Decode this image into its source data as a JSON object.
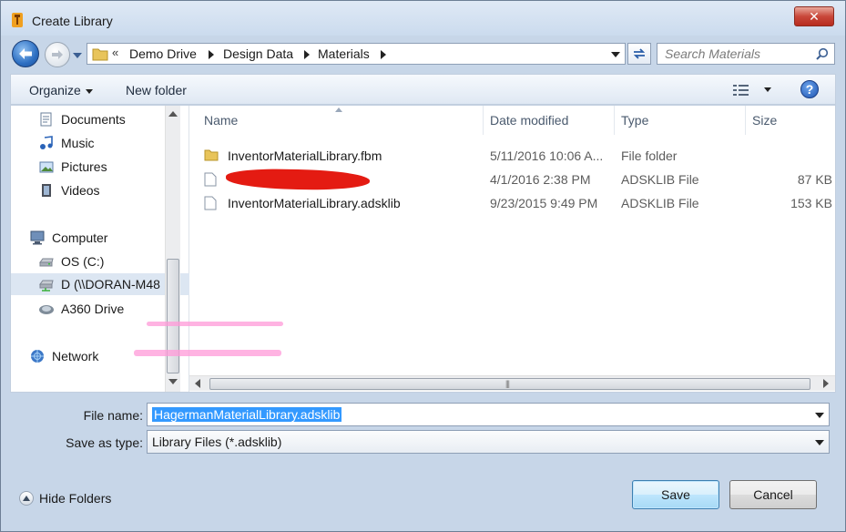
{
  "window": {
    "title": "Create Library",
    "close_label": "✕"
  },
  "address": {
    "overflow": "«",
    "crumbs": [
      "Demo Drive",
      "Design Data",
      "Materials"
    ]
  },
  "search": {
    "placeholder": "Search Materials"
  },
  "toolbar": {
    "organize": "Organize",
    "new_folder": "New folder",
    "help": "?"
  },
  "nav": {
    "items": [
      {
        "label": "Documents",
        "icon": "documents-icon"
      },
      {
        "label": "Music",
        "icon": "music-icon"
      },
      {
        "label": "Pictures",
        "icon": "pictures-icon"
      },
      {
        "label": "Videos",
        "icon": "videos-icon"
      },
      {
        "label": "Computer",
        "icon": "computer-icon"
      },
      {
        "label": "OS (C:)",
        "icon": "drive-icon"
      },
      {
        "label": "D (\\\\DORAN-M48",
        "icon": "network-drive-icon",
        "selected": true
      },
      {
        "label": "A360 Drive",
        "icon": "cloud-drive-icon"
      },
      {
        "label": "Network",
        "icon": "network-icon"
      }
    ]
  },
  "list": {
    "columns": {
      "name": "Name",
      "date": "Date modified",
      "type": "Type",
      "size": "Size"
    },
    "rows": [
      {
        "name": "InventorMaterialLibrary.fbm",
        "date": "5/11/2016 10:06 A...",
        "type": "File folder",
        "size": "",
        "icon": "folder-icon",
        "redacted": false
      },
      {
        "name": "",
        "date": "4/1/2016 2:38 PM",
        "type": "ADSKLIB File",
        "size": "87 KB",
        "icon": "file-icon",
        "redacted": true
      },
      {
        "name": "InventorMaterialLibrary.adsklib",
        "date": "9/23/2015 9:49 PM",
        "type": "ADSKLIB File",
        "size": "153 KB",
        "icon": "file-icon",
        "redacted": false
      }
    ]
  },
  "form": {
    "file_name_label": "File name:",
    "file_name_value": "HagermanMaterialLibrary.adsklib",
    "save_type_label": "Save as type:",
    "save_type_value": "Library Files (*.adsklib)"
  },
  "footer": {
    "hide_folders": "Hide Folders",
    "save": "Save",
    "cancel": "Cancel"
  },
  "colors": {
    "accent": "#3399ff",
    "close": "#c9473a",
    "redaction": "#e41b12"
  }
}
